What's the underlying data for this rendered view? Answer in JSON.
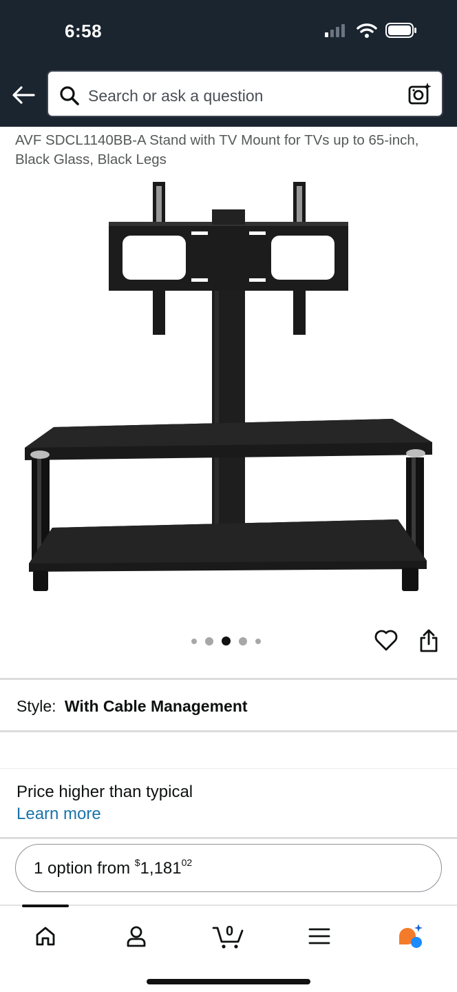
{
  "status_bar": {
    "time": "6:58"
  },
  "search": {
    "placeholder": "Search or ask a question"
  },
  "product": {
    "title": "AVF SDCL1140BB-A Stand with TV Mount for TVs up to 65-inch, Black Glass, Black Legs",
    "image_count": 5,
    "active_image_index": 2
  },
  "style": {
    "label": "Style:",
    "value": "With Cable Management"
  },
  "price_info": {
    "note": "Price higher than typical",
    "learn_more": "Learn more"
  },
  "offer": {
    "prefix": "1 option from",
    "currency": "$",
    "whole": "1,181",
    "fraction": "02"
  },
  "tabbar": {
    "items": [
      "home-icon",
      "account-icon",
      "cart-icon",
      "menu-icon",
      "rufus-icon"
    ],
    "cart_count": "0"
  },
  "colors": {
    "header_bg": "#1b2530",
    "link": "#1a73a8",
    "accent_orange": "#f47b2a",
    "accent_blue": "#1a8cff"
  }
}
